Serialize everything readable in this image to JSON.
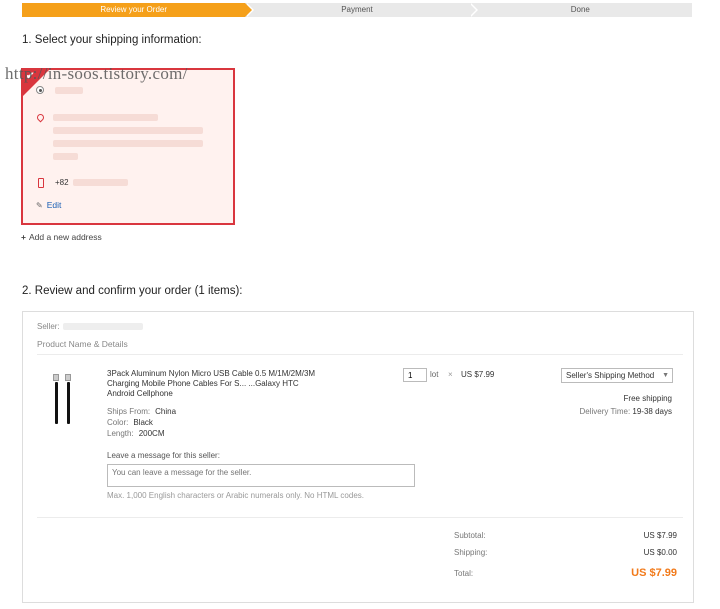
{
  "steps": [
    {
      "label": "Review your Order",
      "active": true
    },
    {
      "label": "Payment",
      "active": false
    },
    {
      "label": "Done",
      "active": false
    }
  ],
  "watermark": "http://in-soos.tistory.com/",
  "section1": {
    "title": "1. Select your shipping information:"
  },
  "address": {
    "phone_prefix": "+82",
    "edit_label": "Edit",
    "selected_mark": "✔"
  },
  "add_address_label": "Add a new address",
  "section2": {
    "title": "2. Review and confirm your order (1 items):"
  },
  "order": {
    "seller_label": "Seller:",
    "column_header": "Product Name & Details",
    "product": {
      "title": "3Pack Aluminum Nylon Micro USB Cable 0.5 M/1M/2M/3M Charging Mobile Phone Cables For S... ...Galaxy HTC Android Cellphone",
      "ships_from_label": "Ships From:",
      "ships_from": "China",
      "color_label": "Color:",
      "color": "Black",
      "length_label": "Length:",
      "length": "200CM"
    },
    "message_label": "Leave a message for this seller:",
    "message_placeholder": "You can leave a message for the seller.",
    "message_hint": "Max. 1,000 English characters or Arabic numerals only. No HTML codes.",
    "quantity": "1",
    "unit": "lot",
    "times": "×",
    "unit_price": "US $7.99",
    "shipping_method": "Seller's Shipping Method",
    "free_shipping": "Free shipping",
    "delivery_label": "Delivery Time:",
    "delivery_time": "19-38 days"
  },
  "summary": {
    "subtotal_label": "Subtotal:",
    "subtotal": "US $7.99",
    "shipping_label": "Shipping:",
    "shipping": "US $0.00",
    "total_label": "Total:",
    "total": "US $7.99"
  },
  "colors": {
    "accent": "#f5a01a",
    "selected_border": "#d9363e",
    "total": "#f27a1a",
    "link": "#1a5fb4"
  }
}
